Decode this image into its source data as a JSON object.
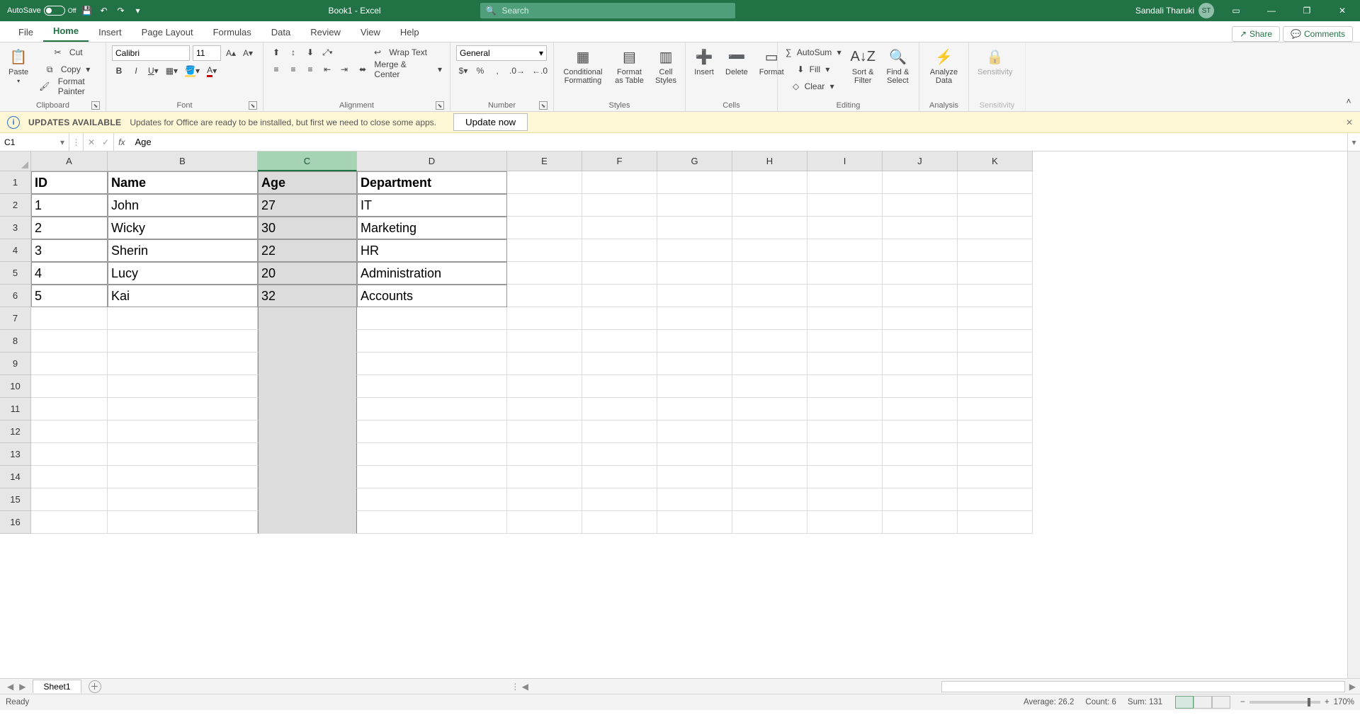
{
  "titlebar": {
    "autosave_label": "AutoSave",
    "autosave_state": "Off",
    "doc_title": "Book1  -  Excel",
    "search_placeholder": "Search",
    "user_name": "Sandali Tharuki",
    "user_initials": "ST"
  },
  "tabs": {
    "items": [
      "File",
      "Home",
      "Insert",
      "Page Layout",
      "Formulas",
      "Data",
      "Review",
      "View",
      "Help"
    ],
    "share": "Share",
    "comments": "Comments"
  },
  "ribbon": {
    "clipboard": {
      "paste": "Paste",
      "cut": "Cut",
      "copy": "Copy",
      "format_painter": "Format Painter",
      "title": "Clipboard"
    },
    "font": {
      "name": "Calibri",
      "size": "11",
      "title": "Font"
    },
    "alignment": {
      "wrap": "Wrap Text",
      "merge": "Merge & Center",
      "title": "Alignment"
    },
    "number": {
      "format": "General",
      "title": "Number"
    },
    "styles": {
      "cond": "Conditional Formatting",
      "format_as": "Format as Table",
      "cell_styles": "Cell Styles",
      "title": "Styles"
    },
    "cells": {
      "insert": "Insert",
      "delete": "Delete",
      "format": "Format",
      "title": "Cells"
    },
    "editing": {
      "autosum": "AutoSum",
      "fill": "Fill",
      "clear": "Clear",
      "sort": "Sort & Filter",
      "find": "Find & Select",
      "title": "Editing"
    },
    "analysis": {
      "analyze": "Analyze Data",
      "title": "Analysis"
    },
    "sensitivity": {
      "label": "Sensitivity",
      "title": "Sensitivity"
    }
  },
  "updates": {
    "title": "UPDATES AVAILABLE",
    "msg": "Updates for Office are ready to be installed, but first we need to close some apps.",
    "button": "Update now"
  },
  "formula_bar": {
    "name_box": "C1",
    "formula": "Age"
  },
  "grid": {
    "col_letters": [
      "A",
      "B",
      "C",
      "D",
      "E",
      "F",
      "G",
      "H",
      "I",
      "J",
      "K"
    ],
    "selected_col_index": 2,
    "row_headers": [
      1,
      2,
      3,
      4,
      5,
      6,
      7,
      8,
      9,
      10,
      11,
      12,
      13,
      14,
      15,
      16
    ],
    "data": [
      {
        "id": "ID",
        "name": "Name",
        "age": "Age",
        "dept": "Department"
      },
      {
        "id": "1",
        "name": "John",
        "age": "27",
        "dept": "IT"
      },
      {
        "id": "2",
        "name": "Wicky",
        "age": "30",
        "dept": "Marketing"
      },
      {
        "id": "3",
        "name": "Sherin",
        "age": "22",
        "dept": "HR"
      },
      {
        "id": "4",
        "name": "Lucy",
        "age": "20",
        "dept": "Administration"
      },
      {
        "id": "5",
        "name": "Kai",
        "age": "32",
        "dept": "Accounts"
      }
    ]
  },
  "sheet_tabs": {
    "active": "Sheet1"
  },
  "status": {
    "ready": "Ready",
    "avg": "Average: 26.2",
    "count": "Count: 6",
    "sum": "Sum: 131",
    "zoom": "170%"
  }
}
